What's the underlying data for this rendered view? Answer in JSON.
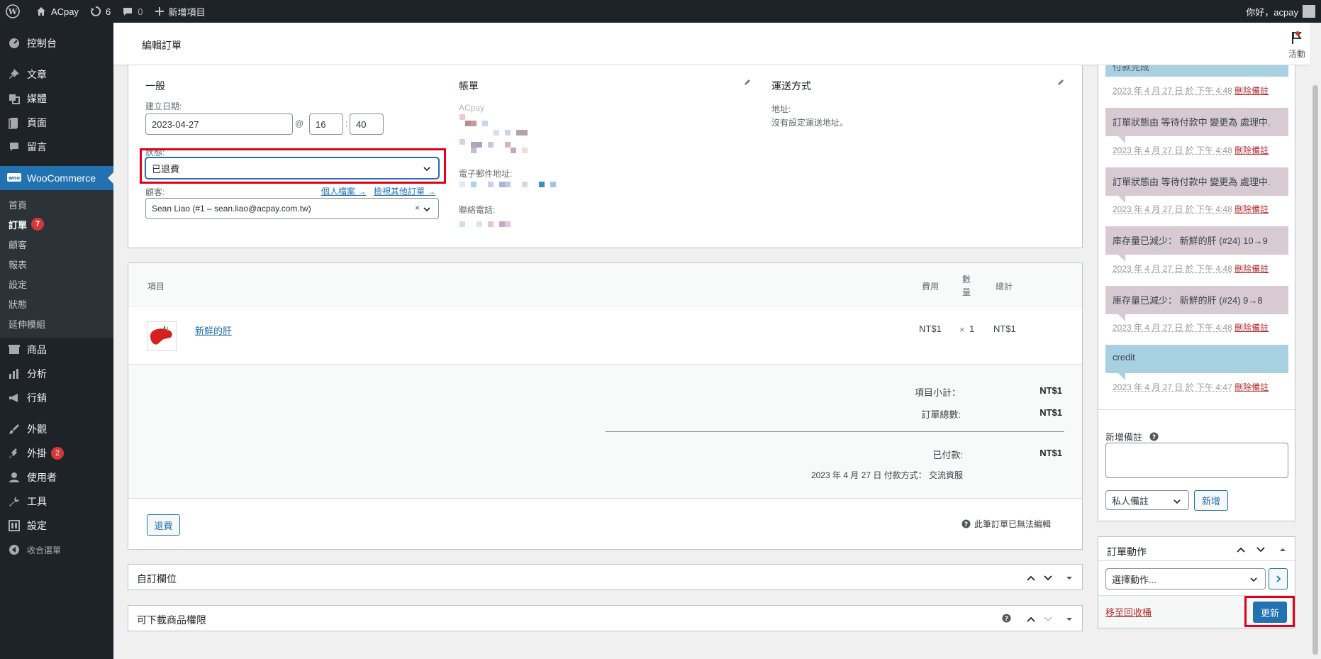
{
  "adminbar": {
    "site_name": "ACpay",
    "updates_count": "6",
    "comments_count": "0",
    "new_label": "新增項目",
    "greeting": "你好，acpay"
  },
  "sidebar": {
    "items": [
      {
        "label": "控制台"
      },
      {
        "label": "文章"
      },
      {
        "label": "媒體"
      },
      {
        "label": "頁面"
      },
      {
        "label": "留言"
      },
      {
        "label": "WooCommerce"
      }
    ],
    "submenu": [
      {
        "label": "首頁"
      },
      {
        "label": "訂單",
        "badge": "7"
      },
      {
        "label": "顧客"
      },
      {
        "label": "報表"
      },
      {
        "label": "設定"
      },
      {
        "label": "狀態"
      },
      {
        "label": "延伸模組"
      }
    ],
    "items2": [
      {
        "label": "商品"
      },
      {
        "label": "分析"
      },
      {
        "label": "行銷"
      },
      {
        "label": "外觀"
      },
      {
        "label": "外掛",
        "badge": "2"
      },
      {
        "label": "使用者"
      },
      {
        "label": "工具"
      },
      {
        "label": "設定"
      },
      {
        "label": "收合選單"
      }
    ]
  },
  "header": {
    "title": "編輯訂單",
    "activity_label": "活動"
  },
  "order": {
    "general_title": "一般",
    "date_label": "建立日期:",
    "date_value": "2023-04-27",
    "at": "@",
    "hour": "16",
    "minute": "40",
    "colon": ":",
    "status_label": "狀態:",
    "status_value": "已退費",
    "customer_label": "顧客:",
    "profile_link": "個人檔案 →",
    "other_orders_link": "檢視其他訂單 →",
    "customer_value": "Sean Liao (#1 – sean.liao@acpay.com.tw)",
    "clear_x": "×",
    "billing_title": "帳單",
    "billing_company": "ACpay",
    "email_label": "電子郵件地址:",
    "phone_label": "聯絡電話:",
    "shipping_title": "運送方式",
    "address_label": "地址:",
    "no_address": "沒有設定運送地址。"
  },
  "items_table": {
    "col_item": "項目",
    "col_cost": "費用",
    "col_qty": "數量",
    "col_total": "總計",
    "rows": [
      {
        "name": "新鮮的肝",
        "cost": "NT$1",
        "qty_x": "×",
        "qty": "1",
        "total": "NT$1"
      }
    ],
    "subtotal_label": "項目小計：",
    "subtotal_value": "NT$1",
    "order_total_label": "訂單總數:",
    "order_total_value": "NT$1",
    "paid_label": "已付款:",
    "paid_value": "NT$1",
    "paid_meta": "2023 年 4 月 27 日 付款方式： 交流資服",
    "refund_button": "退費",
    "not_editable": "此筆訂單已無法編輯"
  },
  "custom_fields_title": "自訂欄位",
  "downloads_title": "可下載商品權限",
  "notes": {
    "top_partial": "付款完成",
    "items": [
      {
        "text": "",
        "meta_date": "2023 年 4 月 27 日 於 下午 4:48",
        "delete": "刪除備註"
      },
      {
        "text": "訂單狀態由 等待付款中 變更為 處理中.",
        "meta_date": "2023 年 4 月 27 日 於 下午 4:48",
        "delete": "刪除備註"
      },
      {
        "text": "訂單狀態由 等待付款中 變更為 處理中.",
        "meta_date": "2023 年 4 月 27 日 於 下午 4:48",
        "delete": "刪除備註"
      },
      {
        "text": "庫存量已減少： 新鮮的肝 (#24) 10→9",
        "meta_date": "2023 年 4 月 27 日 於 下午 4:48",
        "delete": "刪除備註"
      },
      {
        "text": "庫存量已減少： 新鮮的肝 (#24) 9→8",
        "meta_date": "2023 年 4 月 27 日 於 下午 4:48",
        "delete": "刪除備註"
      },
      {
        "text": "credit",
        "meta_date": "2023 年 4 月 27 日 於 下午 4:47",
        "delete": "刪除備註"
      }
    ],
    "add_note_label": "新增備註",
    "note_type_value": "私人備註",
    "add_button": "新增"
  },
  "order_actions": {
    "title": "訂單動作",
    "select_value": "選擇動作...",
    "trash_link": "移至回收桶",
    "update_button": "更新"
  },
  "colors": {
    "admin_dark": "#1d2327",
    "accent": "#2271b1",
    "note_purple": "#d7cad2",
    "note_blue": "#a7d0e0",
    "highlight": "#e0001b"
  }
}
